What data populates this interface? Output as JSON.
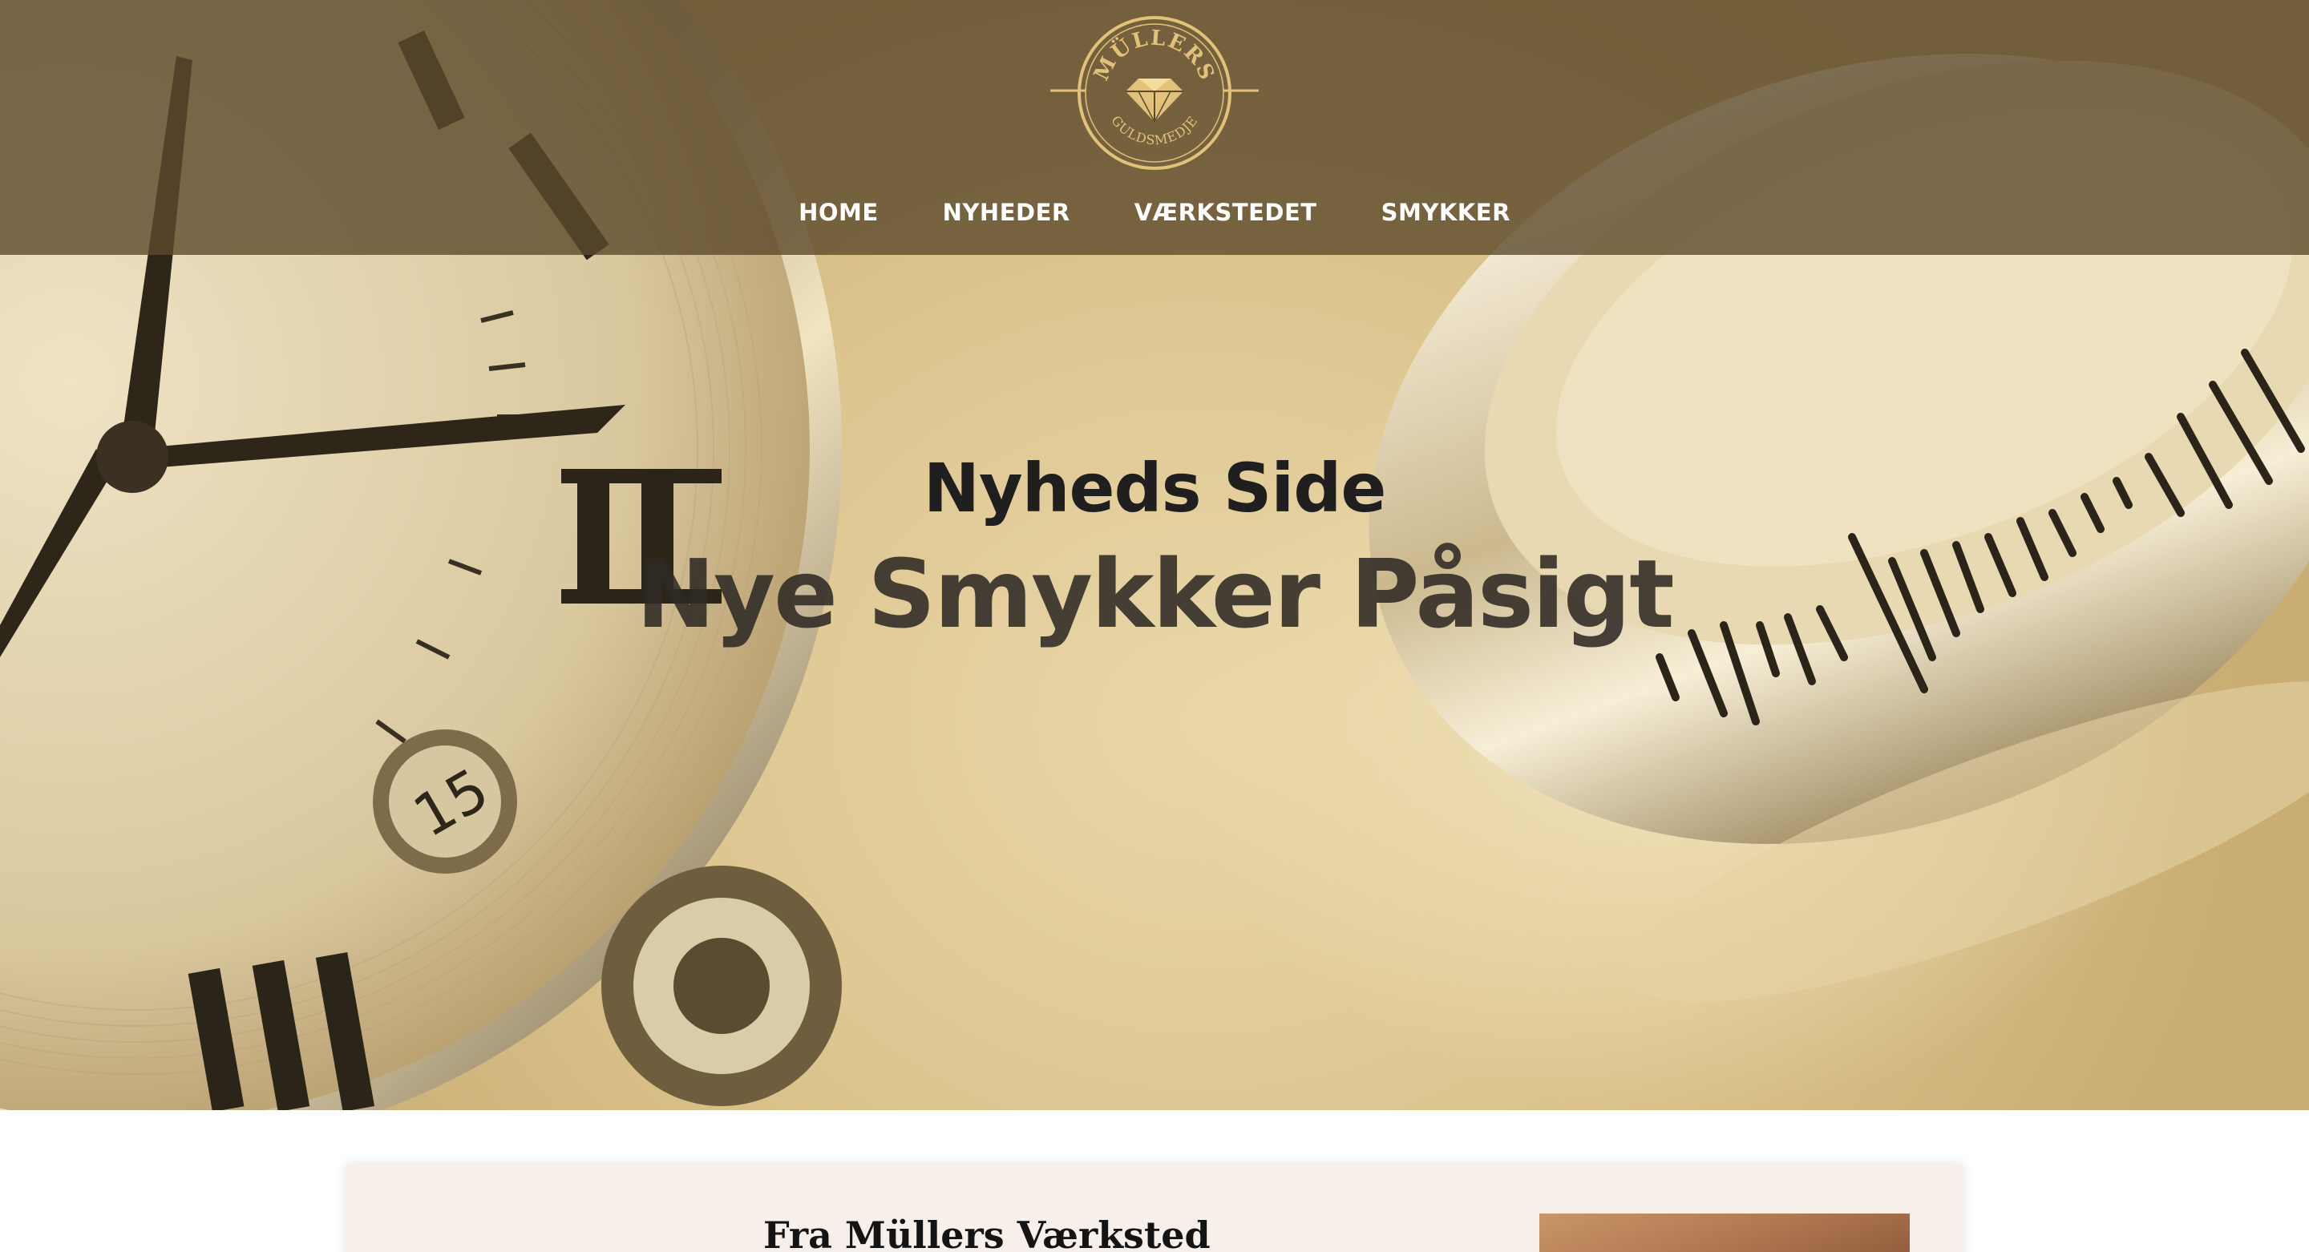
{
  "header": {
    "logo": {
      "top_text": "MÜLLERS",
      "bottom_text": "GULDSMEDJE",
      "icon": "diamond-icon",
      "color": "#e2c27a"
    },
    "nav": [
      {
        "label": "HOME"
      },
      {
        "label": "NYHEDER"
      },
      {
        "label": "VÆRKSTEDET"
      },
      {
        "label": "SMYKKER"
      }
    ],
    "background": "#5c4a2c"
  },
  "hero": {
    "title": "Nyheds Side",
    "subtitle": "Nye Smykker Påsigt",
    "image": "watch-and-ring-photo"
  },
  "content": {
    "heading": "Fra Müllers Værksted",
    "image": "jewelry-photo"
  },
  "colors": {
    "accent_gold": "#e2c27a",
    "card_background": "#f7efea",
    "title_text": "#1f1f1f"
  }
}
